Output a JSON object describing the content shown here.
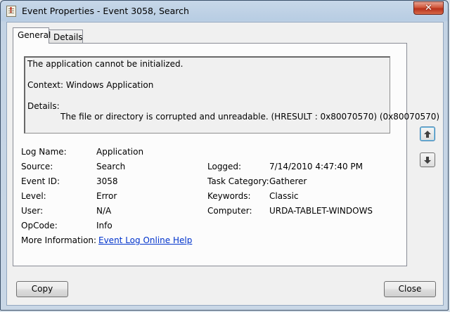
{
  "window": {
    "title": "Event Properties - Event 3058, Search",
    "close_glyph": "✕"
  },
  "tabs": [
    {
      "label": "General"
    },
    {
      "label": "Details"
    }
  ],
  "message": {
    "line1": "The application cannot be initialized.",
    "line2": "Context: Windows Application",
    "line3": "Details:",
    "line4": "The file or directory is corrupted and unreadable.  (HRESULT : 0x80070570) (0x80070570)"
  },
  "fields": {
    "log_name": {
      "label": "Log Name:",
      "value": "Application"
    },
    "source": {
      "label": "Source:",
      "value": "Search"
    },
    "logged": {
      "label": "Logged:",
      "value": "7/14/2010 4:47:40 PM"
    },
    "event_id": {
      "label": "Event ID:",
      "value": "3058"
    },
    "task_category": {
      "label": "Task Category:",
      "value": "Gatherer"
    },
    "level": {
      "label": "Level:",
      "value": "Error"
    },
    "keywords": {
      "label": "Keywords:",
      "value": "Classic"
    },
    "user": {
      "label": "User:",
      "value": "N/A"
    },
    "computer": {
      "label": "Computer:",
      "value": "URDA-TABLET-WINDOWS"
    },
    "opcode": {
      "label": "OpCode:",
      "value": "Info"
    },
    "more_info": {
      "label": "More Information:",
      "link": "Event Log Online Help"
    }
  },
  "buttons": {
    "copy": "Copy",
    "close": "Close"
  },
  "icons": {
    "up": "arrow-up-icon",
    "down": "arrow-down-icon"
  }
}
